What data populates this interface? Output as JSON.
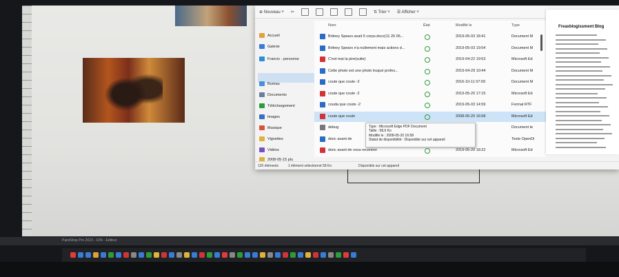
{
  "explorer": {
    "toolbar": {
      "new_label": "Nouveau",
      "sort_label": "Trier",
      "view_label": "Afficher"
    },
    "nav": {
      "items": [
        {
          "label": "Accueil",
          "color": "#e0a23a"
        },
        {
          "label": "Galerie",
          "color": "#3a7bd5"
        },
        {
          "label": "Francis - personne",
          "color": "#2a8fd8"
        },
        {
          "label": "Bureau",
          "color": "#4a90d9"
        },
        {
          "label": "Documents",
          "color": "#6a7f9a"
        },
        {
          "label": "Téléchargement",
          "color": "#2f9a3c"
        },
        {
          "label": "Images",
          "color": "#3a6fc4"
        },
        {
          "label": "Musique",
          "color": "#d9533a"
        },
        {
          "label": "Vignettes",
          "color": "#e0b23a"
        },
        {
          "label": "Vidéos",
          "color": "#7a4fc4"
        },
        {
          "label": "2008-05-15 plu",
          "color": "#e0b23a"
        }
      ]
    },
    "columns": {
      "name": "Nom",
      "status": "État",
      "modified": "Modifié le",
      "type": "Type"
    },
    "files": [
      {
        "name": "Britney Spears avait 5 corps.docx(11 26 06...",
        "date": "2019-05-03 18:41",
        "type": "Document M",
        "icon_color": "#2b6cc4"
      },
      {
        "name": "Britney Spears n'a nullement mais actions d...",
        "date": "2019-05-03 19:54",
        "type": "Document M",
        "icon_color": "#2b6cc4"
      },
      {
        "name": "C'est mai la pire(suite)",
        "date": "2019-04-22 19:53",
        "type": "Microsoft Ed",
        "icon_color": "#d13438"
      },
      {
        "name": "Cette photo est une photo truqué profes...",
        "date": "2019-04-29 10:44",
        "type": "Document M",
        "icon_color": "#2b6cc4"
      },
      {
        "name": "coute que coute -2",
        "date": "2016-10-11 07:09",
        "type": "Document M",
        "icon_color": "#2b6cc4"
      },
      {
        "name": "coute que coute -2",
        "date": "2019-05-20 17:15",
        "type": "Microsoft Ed",
        "icon_color": "#d13438"
      },
      {
        "name": "couda que coute -2",
        "date": "2019-05-03 14:59",
        "type": "Format RTF",
        "icon_color": "#2b6cc4"
      },
      {
        "name": "coute que coute",
        "date": "2008-05-20 16:58",
        "type": "Microsoft Ed",
        "icon_color": "#d13438"
      },
      {
        "name": "debug",
        "date": "...-18 22:50",
        "type": "Document te",
        "icon_color": "#777777"
      },
      {
        "name": "donc avant de",
        "date": "...-20 18:23",
        "type": "Texte OpenDi",
        "icon_color": "#2b6cc4"
      },
      {
        "name": "donc avant de vous recentrer",
        "date": "2019-05-20 18:22",
        "type": "Microsoft Ed",
        "icon_color": "#d13438"
      }
    ],
    "selected_index": 7,
    "status": {
      "count": "120 éléments",
      "selected": "1 élément sélectionné 58 Ko",
      "avail": "Disponible sur cet appareil"
    }
  },
  "tooltip": {
    "lines": [
      "Type : Microsoft Edge PDF Document",
      "Taille : 58,6 Ko",
      "Modifié le : 2008-05-20 16:58",
      "Statut de disponibilité : Disponible sur cet appareil"
    ]
  },
  "preview": {
    "title": "Freaxblogissment Blog"
  },
  "editor": {
    "status": "PaintShop Pro 2023 - 10% - Editeur"
  },
  "taskbar": {
    "apps": [
      "#e23b3b",
      "#3a7bd5",
      "#3a7bd5",
      "#d9a33a",
      "#3a7bd5",
      "#2f9a3c",
      "#3a7bd5",
      "#d13438",
      "#888888",
      "#3a7bd5",
      "#2f9a3c",
      "#e0b23a",
      "#d13438",
      "#3a7bd5",
      "#888888",
      "#e0b23a",
      "#3a7bd5",
      "#d13438",
      "#2f9a3c",
      "#3a7bd5",
      "#e23b3b",
      "#888888",
      "#2f9a3c",
      "#3a7bd5",
      "#3a7bd5",
      "#e0b23a",
      "#888888",
      "#3a7bd5",
      "#d13438",
      "#2f9a3c",
      "#3a7bd5",
      "#e0b23a",
      "#d13438",
      "#3a7bd5",
      "#888888",
      "#2f9a3c",
      "#e23b3b",
      "#3a7bd5"
    ]
  }
}
